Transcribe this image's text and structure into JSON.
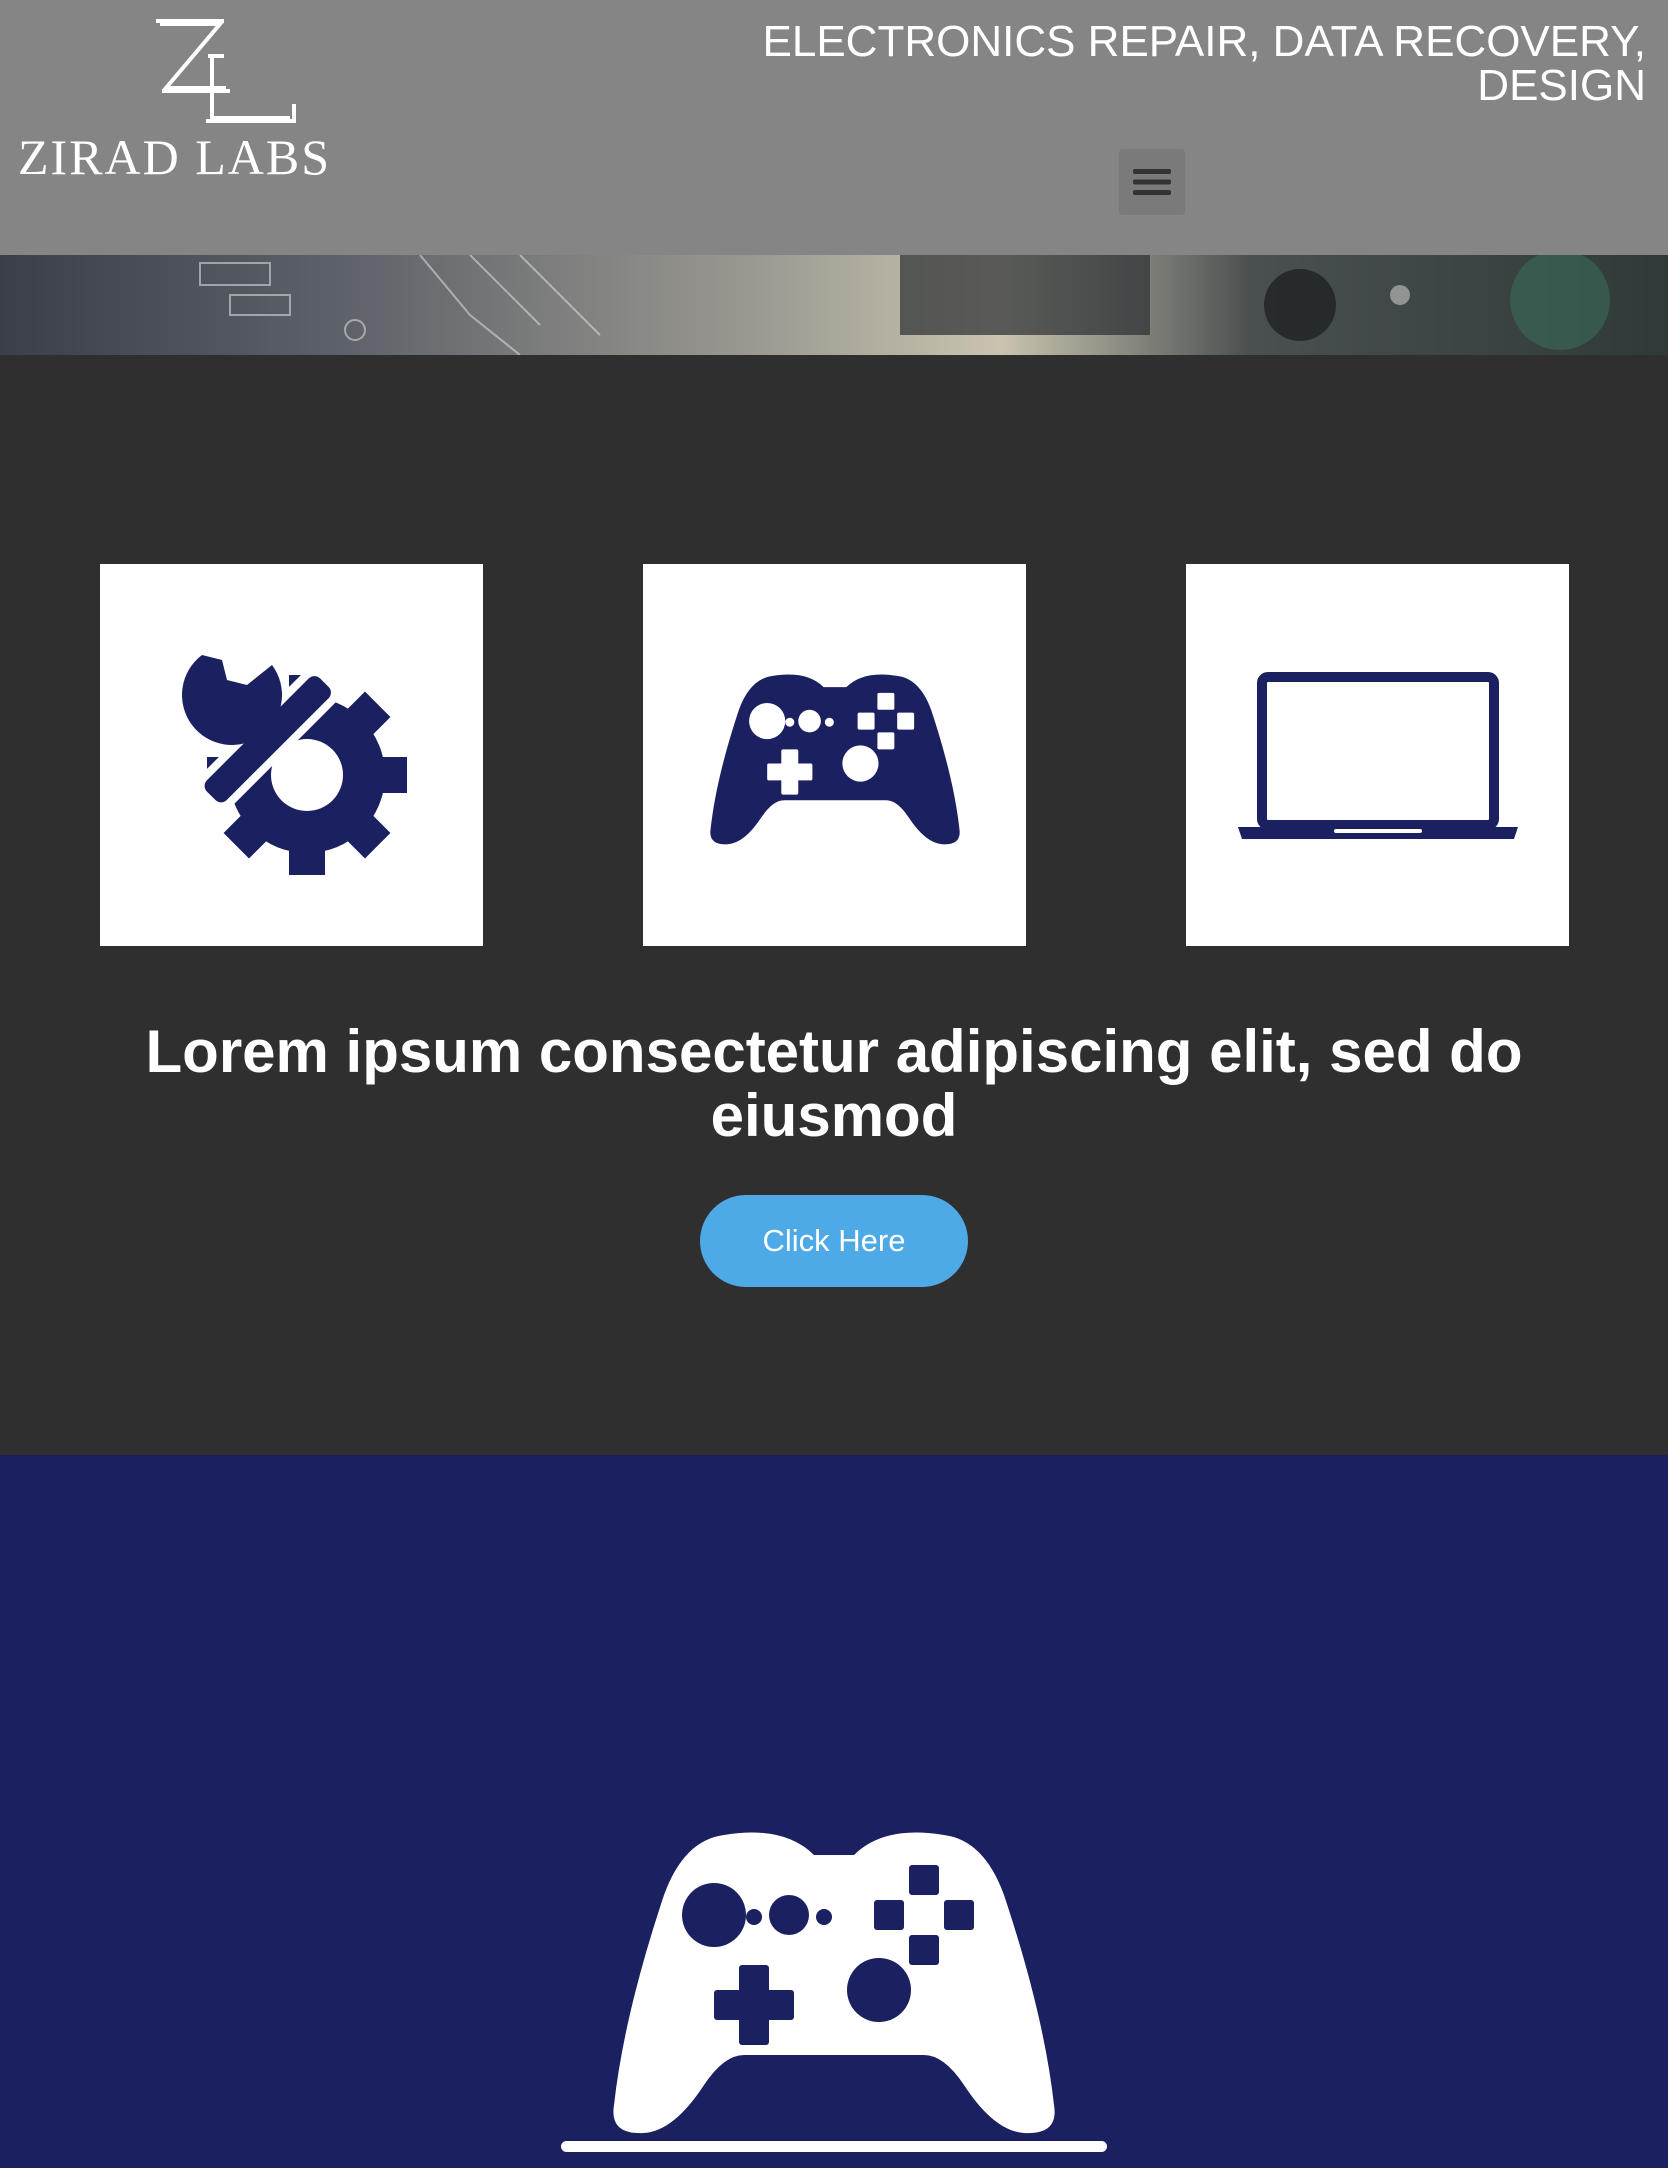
{
  "header": {
    "logo": {
      "text": "ZIRAD LABS"
    },
    "tagline": "ELECTRONICS REPAIR, DATA RECOVERY, DESIGN",
    "menu_icon": "hamburger-menu-icon"
  },
  "services": {
    "cards": [
      {
        "icon": "wrench-gear-icon"
      },
      {
        "icon": "gamepad-icon"
      },
      {
        "icon": "laptop-icon"
      }
    ],
    "headline": "Lorem ipsum consectetur adipiscing elit, sed do eiusmod",
    "cta_label": "Click Here"
  },
  "feature": {
    "icon": "gamepad-icon"
  },
  "colors": {
    "header_bg": "#858585",
    "dark_bg": "#2f2f2f",
    "navy": "#1a2060",
    "accent": "#4eaae6"
  }
}
